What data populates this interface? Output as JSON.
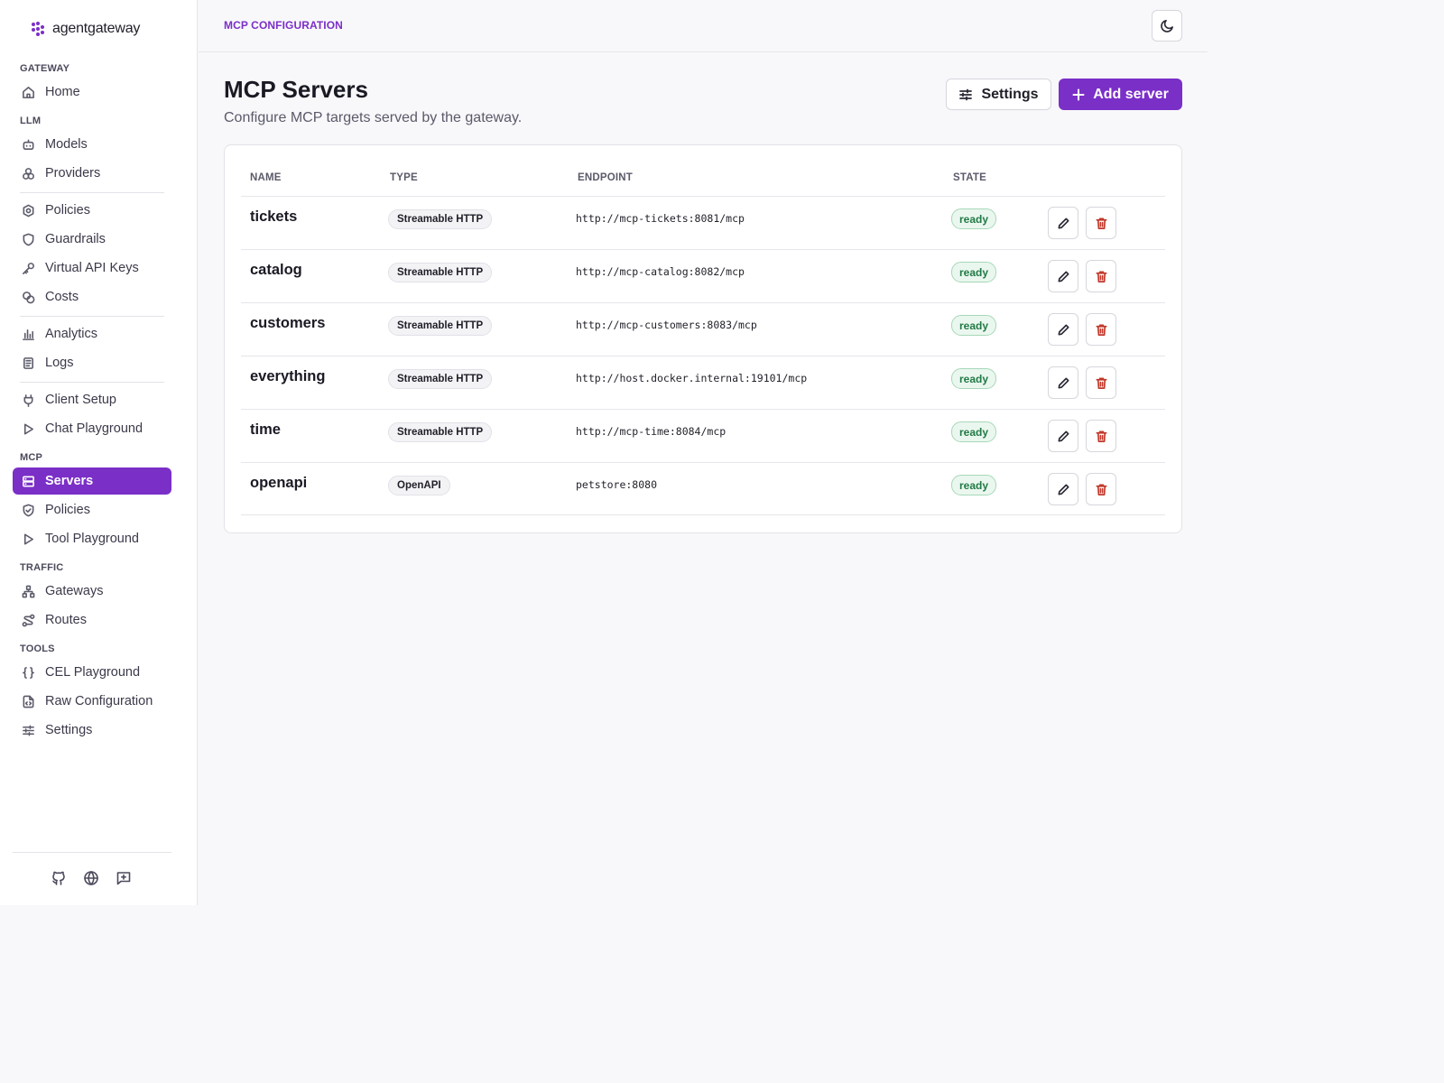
{
  "brand": {
    "name": "agentgateway",
    "logo_icon": "agentgateway-logo-icon",
    "accent": "#7a2fc7"
  },
  "sidebar": {
    "sections": {
      "gateway": "GATEWAY",
      "llm": "LLM",
      "mcp": "MCP",
      "traffic": "TRAFFIC",
      "tools": "TOOLS"
    },
    "items": {
      "home": "Home",
      "models": "Models",
      "providers": "Providers",
      "policies": "Policies",
      "guardrails": "Guardrails",
      "virtual_api_keys": "Virtual API Keys",
      "costs": "Costs",
      "analytics": "Analytics",
      "logs": "Logs",
      "client_setup": "Client Setup",
      "chat_playground": "Chat Playground",
      "servers": "Servers",
      "mcp_policies": "Policies",
      "tool_playground": "Tool Playground",
      "gateways": "Gateways",
      "routes": "Routes",
      "cel_playground": "CEL Playground",
      "raw_configuration": "Raw Configuration",
      "settings": "Settings"
    },
    "active_item": "servers",
    "footer_icons": [
      "github-icon",
      "globe-icon",
      "feedback-icon"
    ]
  },
  "header": {
    "breadcrumb": "MCP CONFIGURATION",
    "theme_toggle_icon": "moon-icon"
  },
  "page": {
    "title": "MCP Servers",
    "subtitle": "Configure MCP targets served by the gateway.",
    "settings_button": "Settings",
    "add_button": "Add server"
  },
  "table": {
    "columns": {
      "name": "NAME",
      "type": "TYPE",
      "endpoint": "ENDPOINT",
      "state": "STATE"
    },
    "rows": [
      {
        "name": "tickets",
        "type": "Streamable HTTP",
        "endpoint": "http://mcp-tickets:8081/mcp",
        "state": "ready"
      },
      {
        "name": "catalog",
        "type": "Streamable HTTP",
        "endpoint": "http://mcp-catalog:8082/mcp",
        "state": "ready"
      },
      {
        "name": "customers",
        "type": "Streamable HTTP",
        "endpoint": "http://mcp-customers:8083/mcp",
        "state": "ready"
      },
      {
        "name": "everything",
        "type": "Streamable HTTP",
        "endpoint": "http://host.docker.internal:19101/mcp",
        "state": "ready"
      },
      {
        "name": "time",
        "type": "Streamable HTTP",
        "endpoint": "http://mcp-time:8084/mcp",
        "state": "ready"
      },
      {
        "name": "openapi",
        "type": "OpenAPI",
        "endpoint": "petstore:8080",
        "state": "ready"
      }
    ]
  },
  "colors": {
    "accent": "#7a2fc7",
    "ready_text": "#227a46",
    "ready_bg": "#eaf7ef",
    "delete": "#c0392b"
  }
}
